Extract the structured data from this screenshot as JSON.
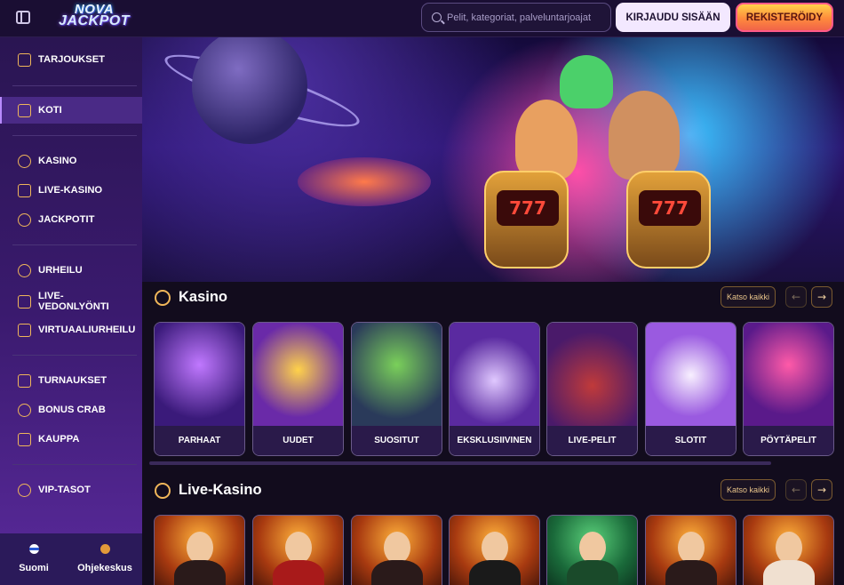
{
  "header": {
    "logo_line1": "NOVA",
    "logo_line2": "JACKPOT",
    "search_placeholder": "Pelit, kategoriat, palveluntarjoajat",
    "login_label": "KIRJAUDU SISÄÄN",
    "register_label": "REKISTERÖIDY"
  },
  "sidebar": {
    "items": [
      {
        "label": "TARJOUKSET",
        "icon": "gift-icon"
      },
      {
        "label": "KOTI",
        "icon": "home-icon",
        "active": true
      },
      {
        "label": "KASINO",
        "icon": "chip-icon"
      },
      {
        "label": "LIVE-KASINO",
        "icon": "spade-icon"
      },
      {
        "label": "JACKPOTIT",
        "icon": "seven-icon"
      },
      {
        "label": "URHEILU",
        "icon": "ball-icon"
      },
      {
        "label": "LIVE-VEDONLYÖNTI",
        "icon": "live-play-icon"
      },
      {
        "label": "VIRTUAALIURHEILU",
        "icon": "gamepad-icon"
      },
      {
        "label": "TURNAUKSET",
        "icon": "trophy-icon"
      },
      {
        "label": "BONUS CRAB",
        "icon": "crab-icon"
      },
      {
        "label": "KAUPPA",
        "icon": "shop-icon"
      },
      {
        "label": "VIP-TASOT",
        "icon": "diamond-icon"
      }
    ],
    "footer": {
      "language": "Suomi",
      "help": "Ohjekeskus"
    }
  },
  "hero": {
    "slot_left": "777",
    "slot_right": "777"
  },
  "sections": {
    "casino": {
      "title": "Kasino",
      "see_all": "Katso kaikki",
      "cards": [
        "PARHAAT",
        "UUDET",
        "SUOSITUT",
        "EKSKLUSIIVINEN",
        "LIVE-PELIT",
        "SLOTIT",
        "PÖYTÄPELIT"
      ]
    },
    "live_casino": {
      "title": "Live-Kasino",
      "see_all": "Katso kaikki"
    }
  },
  "colors": {
    "accent": "#f0b65a",
    "sidebar_top": "#2a1552",
    "register_gradient_top": "#ffd24a"
  }
}
